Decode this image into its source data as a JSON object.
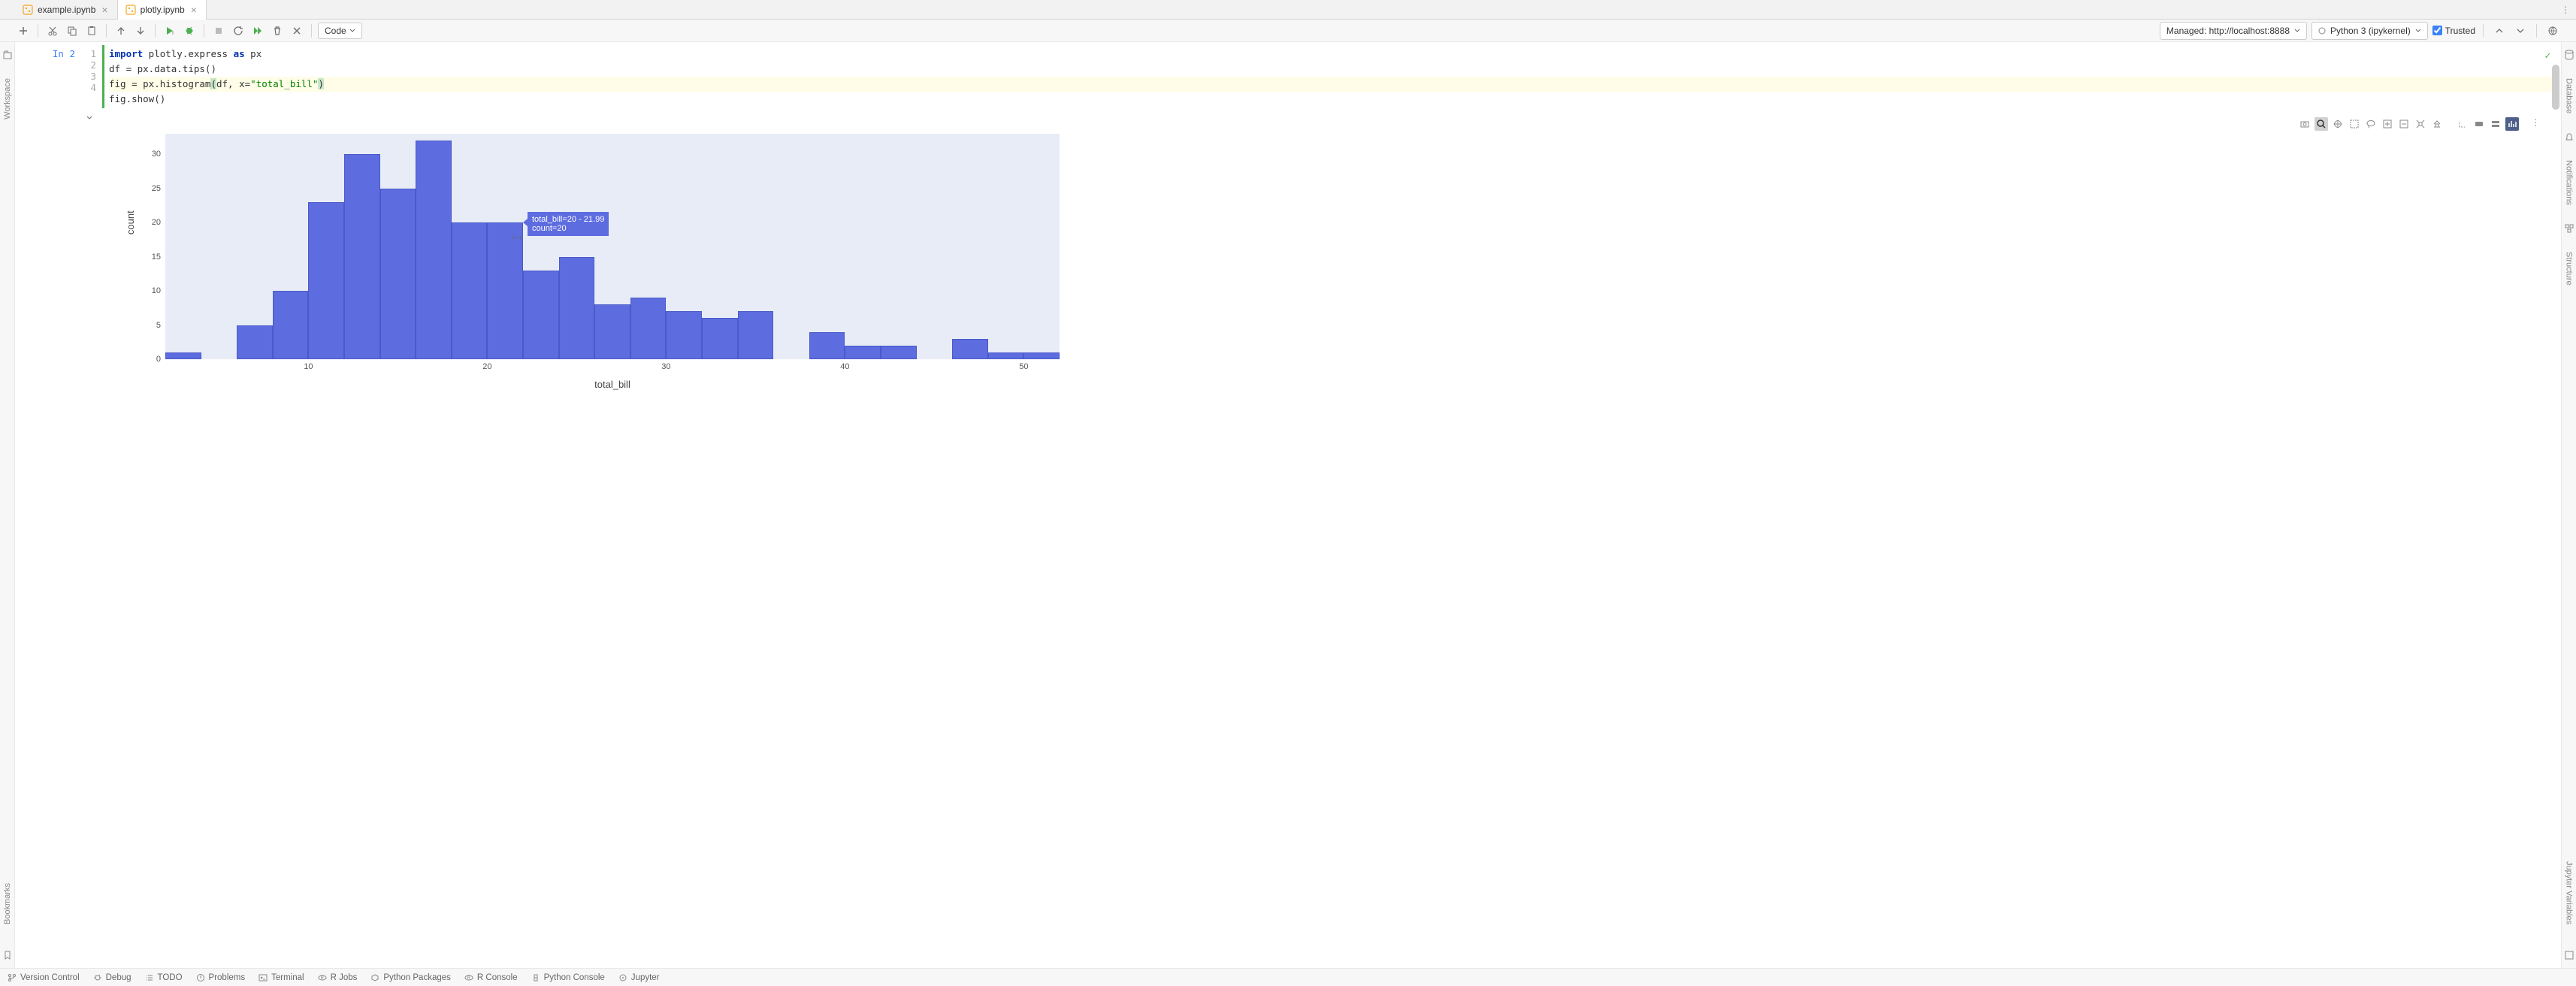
{
  "tabs": [
    {
      "name": "example.ipynb",
      "active": false
    },
    {
      "name": "plotly.ipynb",
      "active": true
    }
  ],
  "toolbar": {
    "cell_type": "Code",
    "managed": "Managed: http://localhost:8888",
    "kernel": "Python 3 (ipykernel)",
    "trusted": "Trusted"
  },
  "cell": {
    "prompt": "In 2",
    "lines": [
      "1",
      "2",
      "3",
      "4"
    ],
    "code": {
      "l1_kw": "import",
      "l1_rest": " plotly.express ",
      "l1_as": "as",
      "l1_px": " px",
      "l2": "df = px.data.tips()",
      "l3_pre": "fig = px.histogram",
      "l3_lp": "(",
      "l3_mid": "df, x=",
      "l3_str": "\"total_bill\"",
      "l3_rp": ")",
      "l4": "fig.show()"
    }
  },
  "tooltip": {
    "line1": "total_bill=20 - 21.99",
    "line2": "count=20"
  },
  "left_tools": {
    "workspace": "Workspace"
  },
  "right_tools": {
    "database": "Database",
    "notifications": "Notifications",
    "structure": "Structure",
    "jupyter": "Jupyter Variables"
  },
  "bottom_tools": {
    "vcs": "Version Control",
    "debug": "Debug",
    "todo": "TODO",
    "problems": "Problems",
    "terminal": "Terminal",
    "rjobs": "R Jobs",
    "pypkg": "Python Packages",
    "rconsole": "R Console",
    "pyconsole": "Python Console",
    "jupyter": "Jupyter"
  },
  "left_gutter_bottom": "Bookmarks",
  "chart_data": {
    "type": "bar",
    "xlabel": "total_bill",
    "ylabel": "count",
    "x_ticks": [
      10,
      20,
      30,
      40,
      50
    ],
    "y_ticks": [
      0,
      5,
      10,
      15,
      20,
      25,
      30
    ],
    "x_range": [
      2,
      52
    ],
    "y_range": [
      0,
      33
    ],
    "bin_width": 2,
    "bars": [
      {
        "x0": 2,
        "count": 1
      },
      {
        "x0": 4,
        "count": 0
      },
      {
        "x0": 6,
        "count": 5
      },
      {
        "x0": 8,
        "count": 10
      },
      {
        "x0": 10,
        "count": 23
      },
      {
        "x0": 12,
        "count": 30
      },
      {
        "x0": 14,
        "count": 25
      },
      {
        "x0": 16,
        "count": 32
      },
      {
        "x0": 18,
        "count": 20
      },
      {
        "x0": 20,
        "count": 20
      },
      {
        "x0": 22,
        "count": 13
      },
      {
        "x0": 24,
        "count": 15
      },
      {
        "x0": 26,
        "count": 8
      },
      {
        "x0": 28,
        "count": 9
      },
      {
        "x0": 30,
        "count": 7
      },
      {
        "x0": 32,
        "count": 6
      },
      {
        "x0": 34,
        "count": 7
      },
      {
        "x0": 36,
        "count": 0
      },
      {
        "x0": 38,
        "count": 4
      },
      {
        "x0": 40,
        "count": 2
      },
      {
        "x0": 42,
        "count": 2
      },
      {
        "x0": 44,
        "count": 0
      },
      {
        "x0": 46,
        "count": 3
      },
      {
        "x0": 48,
        "count": 1
      },
      {
        "x0": 50,
        "count": 1
      }
    ]
  }
}
